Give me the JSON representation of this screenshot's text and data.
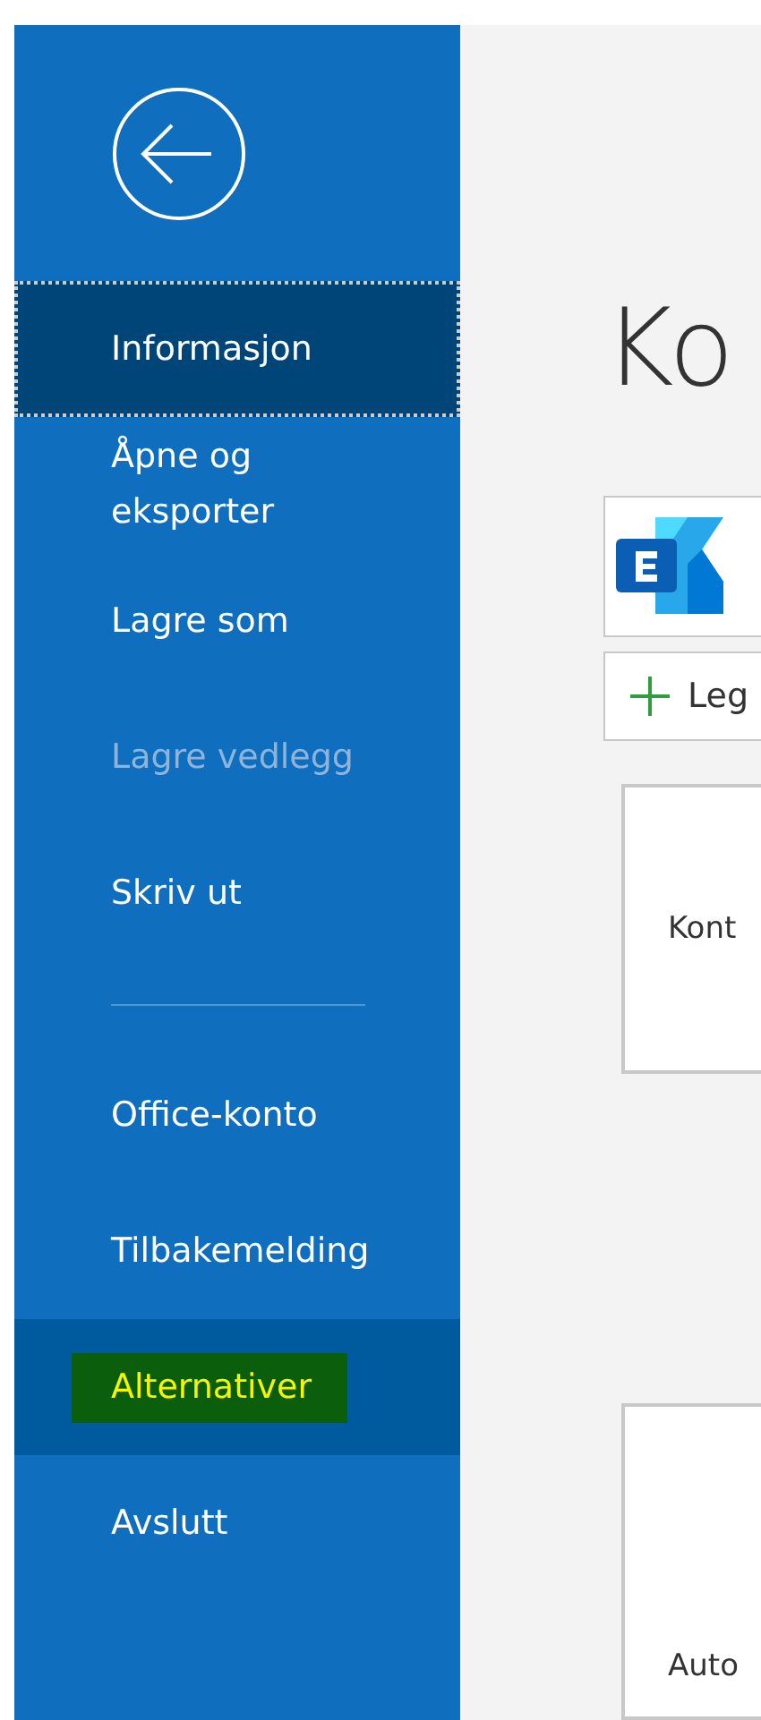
{
  "sidebar": {
    "items": [
      {
        "kind": "item",
        "label": "Informasjon",
        "selected": true,
        "disabled": false,
        "hovered": false,
        "marked": false
      },
      {
        "kind": "item",
        "label": "Åpne og eksporter",
        "selected": false,
        "disabled": false,
        "hovered": false,
        "marked": false
      },
      {
        "kind": "item",
        "label": "Lagre som",
        "selected": false,
        "disabled": false,
        "hovered": false,
        "marked": false
      },
      {
        "kind": "item",
        "label": "Lagre vedlegg",
        "selected": false,
        "disabled": true,
        "hovered": false,
        "marked": false
      },
      {
        "kind": "item",
        "label": "Skriv ut",
        "selected": false,
        "disabled": false,
        "hovered": false,
        "marked": false
      },
      {
        "kind": "divider"
      },
      {
        "kind": "item",
        "label": "Office-konto",
        "selected": false,
        "disabled": false,
        "hovered": false,
        "marked": false
      },
      {
        "kind": "item",
        "label": "Tilbakemelding",
        "selected": false,
        "disabled": false,
        "hovered": false,
        "marked": false
      },
      {
        "kind": "item",
        "label": "Alternativer",
        "selected": false,
        "disabled": false,
        "hovered": true,
        "marked": true
      },
      {
        "kind": "item",
        "label": "Avslutt",
        "selected": false,
        "disabled": false,
        "hovered": false,
        "marked": false
      }
    ]
  },
  "main": {
    "title": "Ko",
    "add_button": "Leg",
    "cards": [
      {
        "label": "Kont"
      },
      {
        "label": "Auto"
      }
    ]
  }
}
